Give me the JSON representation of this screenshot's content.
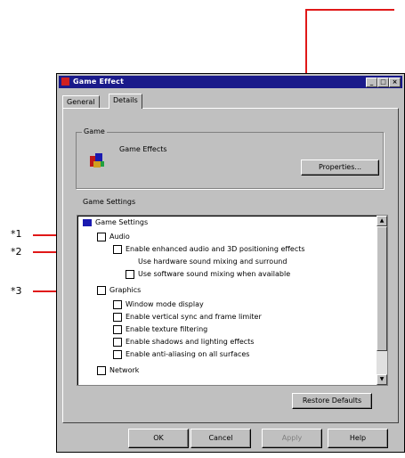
{
  "window": {
    "title": "Game Effect",
    "min": "_",
    "max": "□",
    "close": "×"
  },
  "tabs": [
    "General",
    "Details"
  ],
  "game_group": {
    "label": "Game",
    "name": "Game Effects",
    "button": "Properties..."
  },
  "tree_group": {
    "label": "Game Settings"
  },
  "tree": [
    {
      "text": "Game Settings",
      "indent": 0,
      "box": false
    },
    {
      "text": "Audio",
      "indent": 1,
      "box": true
    },
    {
      "text": "Enable enhanced audio and 3D positioning effects",
      "indent": 2,
      "box": true
    },
    {
      "text": "Use hardware sound mixing and surround",
      "indent": 3,
      "box": false
    },
    {
      "text": "Use software sound mixing when available",
      "indent": 4,
      "box": true
    },
    {
      "text": "Graphics",
      "indent": 1,
      "box": true
    },
    {
      "text": "Window mode display",
      "indent": 2,
      "box": true
    },
    {
      "text": "Enable vertical sync and frame limiter",
      "indent": 2,
      "box": true
    },
    {
      "text": "Enable texture filtering",
      "indent": 2,
      "box": true
    },
    {
      "text": "Enable shadows and lighting effects",
      "indent": 2,
      "box": true
    },
    {
      "text": "Enable anti-aliasing on all surfaces",
      "indent": 2,
      "box": true
    },
    {
      "text": "Network",
      "indent": 1,
      "box": true
    }
  ],
  "defaults_button": "Restore Defaults",
  "footer": {
    "ok": "OK",
    "cancel": "Cancel",
    "apply": "Apply",
    "help": "Help"
  },
  "markers": {
    "m1": "*1",
    "m2": "*2",
    "m3": "*3"
  },
  "colors": {
    "callout": "#e01818",
    "titlebar": "#1a1a8a"
  }
}
